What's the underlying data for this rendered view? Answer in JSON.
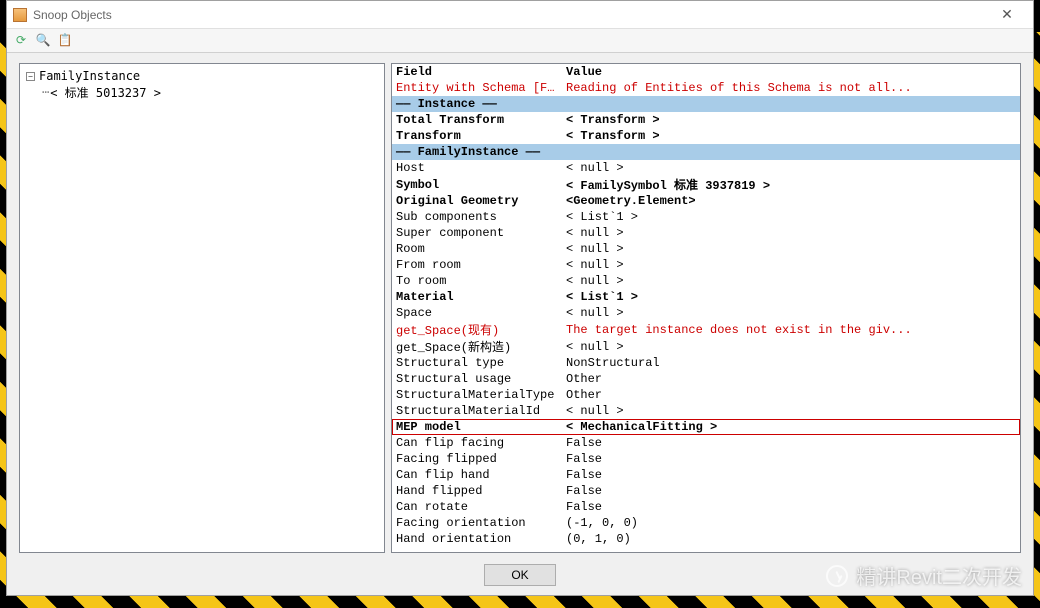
{
  "window": {
    "title": "Snoop Objects"
  },
  "toolbar": {
    "icons": [
      "refresh",
      "search",
      "copy"
    ]
  },
  "tree": {
    "root": {
      "label": "FamilyInstance"
    },
    "child": {
      "label": "< 标准  5013237 >"
    }
  },
  "grid": {
    "headers": {
      "field": "Field",
      "value": "Value"
    },
    "rows": [
      {
        "kind": "red",
        "field": "Entity with Schema [FamilyBro...",
        "value": "Reading of Entities of this Schema is not all..."
      },
      {
        "kind": "section",
        "field": "—— Instance ——",
        "value": ""
      },
      {
        "kind": "bold",
        "field": "Total Transform",
        "value": "< Transform >"
      },
      {
        "kind": "bold",
        "field": "Transform",
        "value": "< Transform >"
      },
      {
        "kind": "section",
        "field": "—— FamilyInstance ——",
        "value": ""
      },
      {
        "kind": "plain",
        "field": "Host",
        "value": "< null >"
      },
      {
        "kind": "bold",
        "field": "Symbol",
        "value": "< FamilySymbol  标准  3937819 >"
      },
      {
        "kind": "bold",
        "field": "Original Geometry",
        "value": "<Geometry.Element>"
      },
      {
        "kind": "plain",
        "field": "Sub components",
        "value": "< List`1 >"
      },
      {
        "kind": "plain",
        "field": "Super component",
        "value": "< null >"
      },
      {
        "kind": "plain",
        "field": "Room",
        "value": "< null >"
      },
      {
        "kind": "plain",
        "field": "From room",
        "value": "< null >"
      },
      {
        "kind": "plain",
        "field": "To room",
        "value": "< null >"
      },
      {
        "kind": "bold",
        "field": "Material",
        "value": "< List`1 >"
      },
      {
        "kind": "plain",
        "field": "Space",
        "value": "< null >"
      },
      {
        "kind": "red",
        "field": "get_Space(现有)",
        "value": "The target instance does not exist in the giv..."
      },
      {
        "kind": "plain",
        "field": "get_Space(新构造)",
        "value": "< null >"
      },
      {
        "kind": "plain",
        "field": "Structural type",
        "value": "NonStructural"
      },
      {
        "kind": "plain",
        "field": "Structural usage",
        "value": "Other"
      },
      {
        "kind": "plain",
        "field": "StructuralMaterialType",
        "value": "Other"
      },
      {
        "kind": "plain",
        "field": "StructuralMaterialId",
        "value": "< null >"
      },
      {
        "kind": "highlight",
        "field": "MEP model",
        "value": "< MechanicalFitting >"
      },
      {
        "kind": "plain",
        "field": "Can flip facing",
        "value": "False"
      },
      {
        "kind": "plain",
        "field": "Facing flipped",
        "value": "False"
      },
      {
        "kind": "plain",
        "field": "Can flip hand",
        "value": "False"
      },
      {
        "kind": "plain",
        "field": "Hand flipped",
        "value": "False"
      },
      {
        "kind": "plain",
        "field": "Can rotate",
        "value": "False"
      },
      {
        "kind": "plain",
        "field": "Facing orientation",
        "value": "(-1, 0, 0)"
      },
      {
        "kind": "plain",
        "field": "Hand orientation",
        "value": "(0, 1, 0)"
      }
    ]
  },
  "footer": {
    "ok_label": "OK"
  },
  "watermark": {
    "text": "精讲Revit二次开发"
  }
}
